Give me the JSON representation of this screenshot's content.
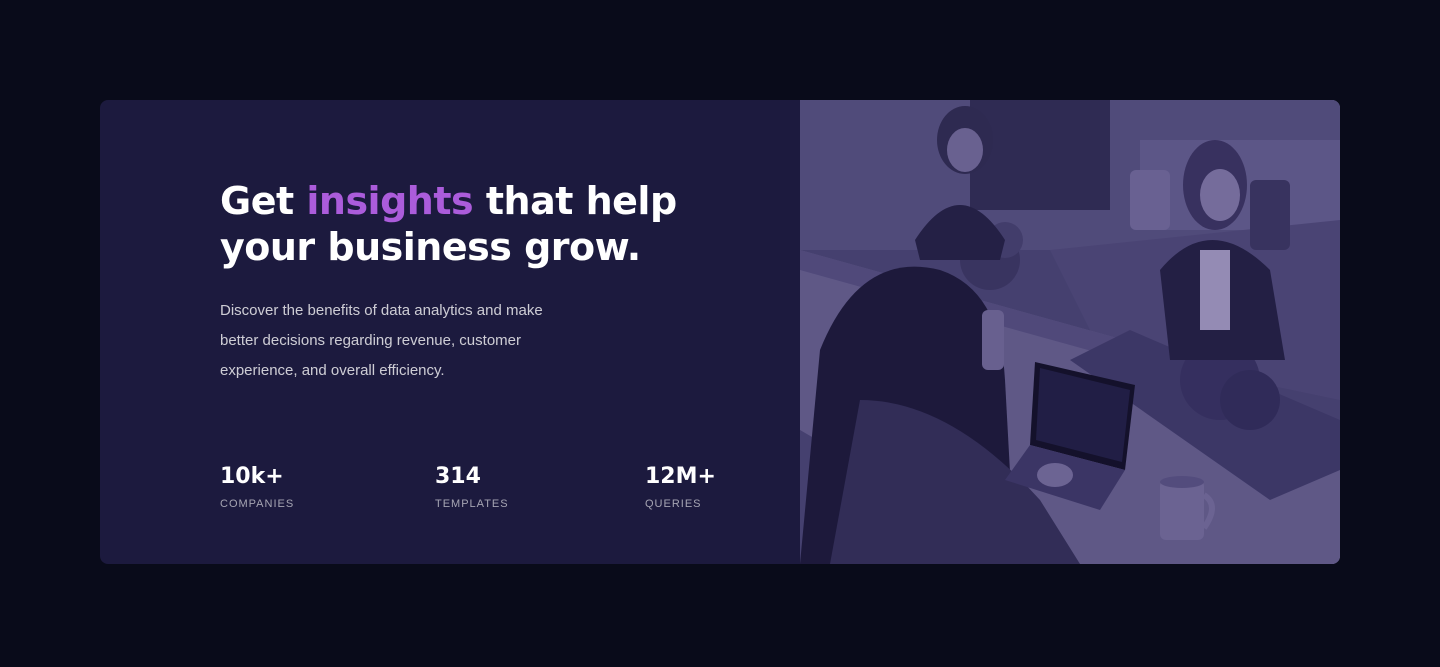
{
  "hero": {
    "title_before": "Get ",
    "title_accent": "insights",
    "title_after": " that help your business grow.",
    "description": "Discover the benefits of data analytics and make better decisions regarding revenue, customer experience, and overall efficiency."
  },
  "stats": [
    {
      "value": "10k+",
      "label": "COMPANIES"
    },
    {
      "value": "314",
      "label": "TEMPLATES"
    },
    {
      "value": "12M+",
      "label": "QUERIES"
    }
  ],
  "image": {
    "icon": "office-photo",
    "overlay_color": "#4d3e8c"
  },
  "colors": {
    "page_background": "#090b1a",
    "card_background": "#1c1a3e",
    "accent": "#ab5cdb",
    "heading": "#ffffff"
  }
}
